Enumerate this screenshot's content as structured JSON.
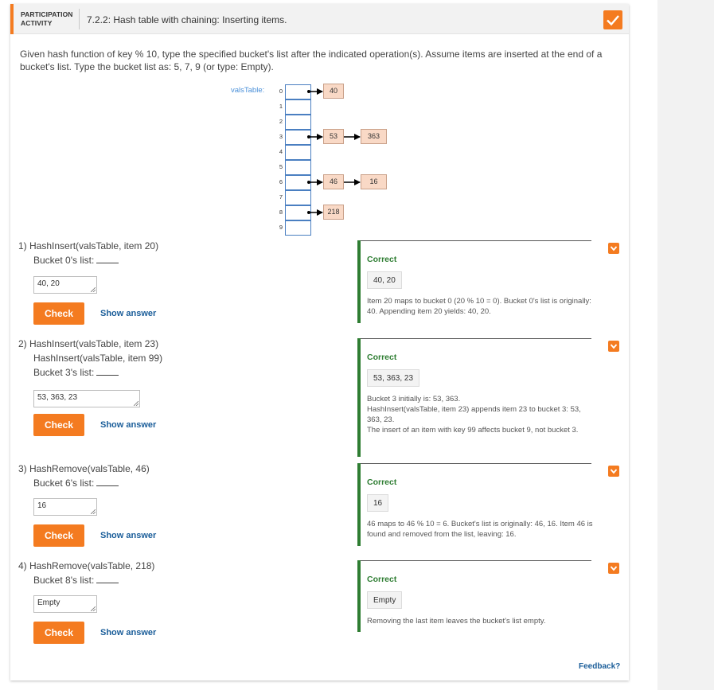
{
  "header": {
    "activity_label": "PARTICIPATION ACTIVITY",
    "title": "7.2.2: Hash table with chaining: Inserting items."
  },
  "instructions": "Given hash function of key % 10, type the specified bucket's list after the indicated operation(s). Assume items are inserted at the end of a bucket's list. Type the bucket list as: 5, 7, 9 (or type: Empty).",
  "diagram": {
    "table_label": "valsTable:",
    "indices": [
      "0",
      "1",
      "2",
      "3",
      "4",
      "5",
      "6",
      "7",
      "8",
      "9"
    ],
    "chains": [
      {
        "bucket": 0,
        "items": [
          "40"
        ]
      },
      {
        "bucket": 3,
        "items": [
          "53",
          "363"
        ]
      },
      {
        "bucket": 6,
        "items": [
          "46",
          "16"
        ]
      },
      {
        "bucket": 8,
        "items": [
          "218"
        ]
      }
    ]
  },
  "questions": [
    {
      "number": "1)",
      "lines": [
        "HashInsert(valsTable, item 20)"
      ],
      "prompt": "Bucket 0's list:",
      "answer": "40, 20",
      "check_label": "Check",
      "show_answer_label": "Show answer",
      "feedback_status": "Correct",
      "feedback_answer": "40, 20",
      "feedback_explanation": "Item 20 maps to bucket 0 (20 % 10 = 0). Bucket 0's list is originally: 40. Appending item 20 yields: 40, 20."
    },
    {
      "number": "2)",
      "lines": [
        "HashInsert(valsTable, item 23)",
        "HashInsert(valsTable, item 99)"
      ],
      "prompt": "Bucket 3's list:",
      "answer": "53, 363, 23",
      "check_label": "Check",
      "show_answer_label": "Show answer",
      "feedback_status": "Correct",
      "feedback_answer": "53, 363, 23",
      "feedback_explanation_lines": [
        "Bucket 3 initially is: 53, 363.",
        "HashInsert(valsTable, item 23) appends item 23 to bucket 3: 53, 363, 23.",
        "The insert of an item with key 99 affects bucket 9, not bucket 3."
      ]
    },
    {
      "number": "3)",
      "lines": [
        "HashRemove(valsTable, 46)"
      ],
      "prompt": "Bucket 6's list:",
      "answer": "16",
      "check_label": "Check",
      "show_answer_label": "Show answer",
      "feedback_status": "Correct",
      "feedback_answer": "16",
      "feedback_explanation": "46 maps to 46 % 10 = 6. Bucket's list is originally: 46, 16. Item 46 is found and removed from the list, leaving: 16."
    },
    {
      "number": "4)",
      "lines": [
        "HashRemove(valsTable, 218)"
      ],
      "prompt": "Bucket 8's list:",
      "answer": "Empty",
      "check_label": "Check",
      "show_answer_label": "Show answer",
      "feedback_status": "Correct",
      "feedback_answer": "Empty",
      "feedback_explanation": "Removing the last item leaves the bucket's list empty."
    }
  ],
  "footer": {
    "feedback_link": "Feedback?"
  },
  "colors": {
    "accent": "#f47b20",
    "correct": "#2e7d32",
    "link": "#1a5d99",
    "node_fill": "#f9d9c6",
    "bucket_border": "#4a7fc1"
  },
  "icons": {
    "completion": "check-icon",
    "collapse": "chevron-down-icon"
  }
}
